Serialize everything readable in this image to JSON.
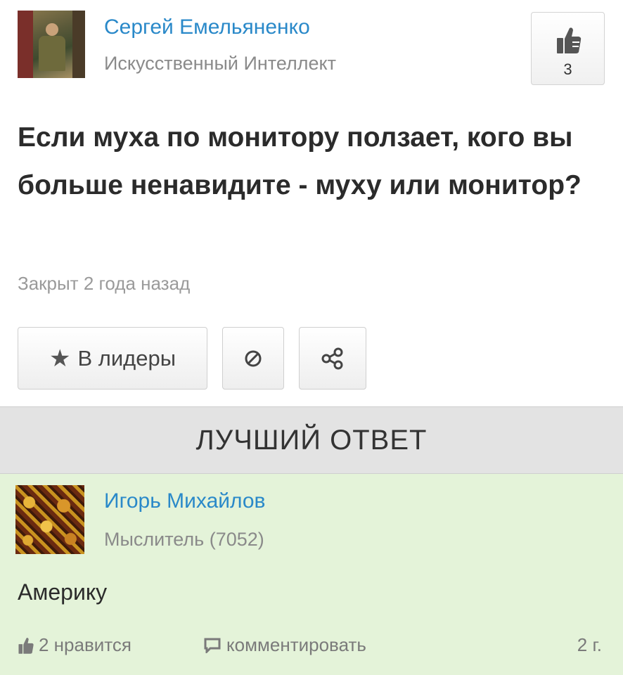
{
  "question": {
    "author": {
      "name": "Сергей Емельяненко",
      "rank": "Искусственный Интеллект"
    },
    "likes": "3",
    "title": "Если муха по монитору ползает, кого вы больше ненавидите - муху или монитор?",
    "status": "Закрыт 2 года назад",
    "actions": {
      "leaders_label": "В лидеры",
      "leaders_icon": "star-icon",
      "block_icon": "block-icon",
      "share_icon": "share-icon"
    }
  },
  "best_answer": {
    "header": "ЛУЧШИЙ ОТВЕТ",
    "author": {
      "name": "Игорь Михайлов",
      "rank": "Мыслитель (7052)"
    },
    "text": "Америку",
    "likes_label": "2 нравится",
    "comment_label": "комментировать",
    "age": "2 г."
  },
  "colors": {
    "link": "#2a89c9",
    "answer_bg": "#e4f3d9",
    "header_bg": "#e3e3e3"
  }
}
